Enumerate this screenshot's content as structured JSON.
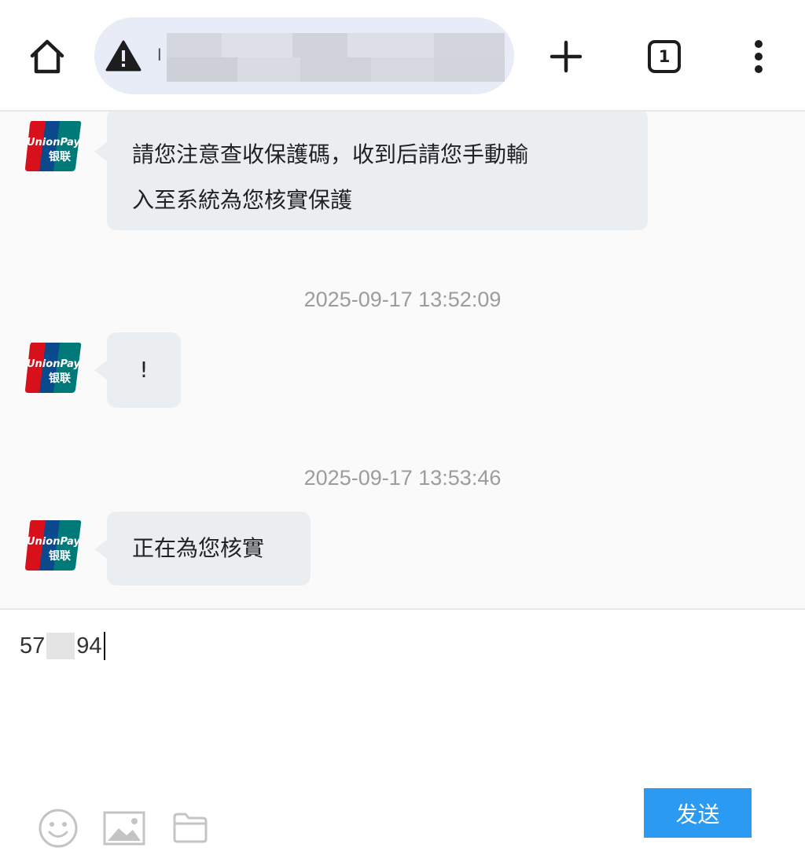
{
  "browser": {
    "url_visible_prefix": "l",
    "open_tab_count": "1"
  },
  "brand": {
    "avatar_logo_text": "UnionPay",
    "avatar_logo_subtext": "银联",
    "colors": {
      "red": "#d7101c",
      "blue": "#0a4a8c",
      "teal": "#007a78"
    }
  },
  "chat": {
    "messages": [
      {
        "sender": "agent",
        "lines": [
          "請您注意查收保護碼，收到后請您手動輸",
          "入至系統為您核實保護"
        ]
      },
      {
        "timestamp": "2025-09-17 13:52:09"
      },
      {
        "sender": "agent",
        "text": "!"
      },
      {
        "timestamp": "2025-09-17 13:53:46"
      },
      {
        "sender": "agent",
        "text": "正在為您核實"
      }
    ]
  },
  "composer": {
    "input_prefix": "57",
    "input_suffix": "94",
    "send_label": "发送"
  },
  "colors": {
    "send_button": "#2b9af3",
    "bubble": "#ebeef0",
    "url_bar": "#e8ecf7",
    "timestamp": "#9c9c9c"
  },
  "icons": [
    "home-icon",
    "warning-icon",
    "plus-icon",
    "tabs-icon",
    "more-vert-icon",
    "emoji-icon",
    "image-icon",
    "folder-icon"
  ]
}
